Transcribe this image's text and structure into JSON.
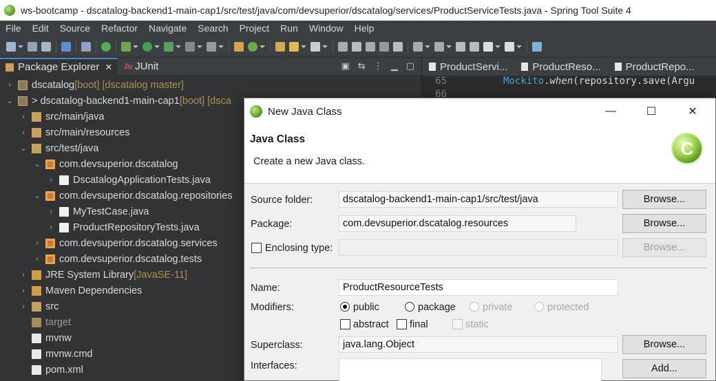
{
  "window": {
    "title": "ws-bootcamp - dscatalog-backend1-main-cap1/src/test/java/com/devsuperior/dscatalog/services/ProductServiceTests.java - Spring Tool Suite 4"
  },
  "menu": [
    "File",
    "Edit",
    "Source",
    "Refactor",
    "Navigate",
    "Search",
    "Project",
    "Run",
    "Window",
    "Help"
  ],
  "left_panel": {
    "tabs": [
      {
        "label": "Package Explorer",
        "close": "✕",
        "active": true
      },
      {
        "label": "JUnit",
        "prefix": "Ju"
      }
    ],
    "tree": [
      {
        "label": "dscatalog",
        "suffix": " [boot] [dscatalog master]",
        "level": 0,
        "chev": "›",
        "icon": "project"
      },
      {
        "label": "> dscatalog-backend1-main-cap1",
        "suffix": " [boot] [dsca",
        "level": 0,
        "chev": "⌄",
        "icon": "project"
      },
      {
        "label": "src/main/java",
        "level": 1,
        "chev": "›",
        "icon": "srcfolder"
      },
      {
        "label": "src/main/resources",
        "level": 1,
        "chev": "›",
        "icon": "srcfolder"
      },
      {
        "label": "src/test/java",
        "level": 1,
        "chev": "⌄",
        "icon": "srcfolder"
      },
      {
        "label": "com.devsuperior.dscatalog",
        "level": 2,
        "chev": "⌄",
        "icon": "pkg"
      },
      {
        "label": "DscatalogApplicationTests.java",
        "level": 3,
        "chev": "›",
        "icon": "java"
      },
      {
        "label": "com.devsuperior.dscatalog.repositories",
        "level": 2,
        "chev": "⌄",
        "icon": "pkg"
      },
      {
        "label": "MyTestCase.java",
        "level": 3,
        "chev": "›",
        "icon": "java"
      },
      {
        "label": "ProductRepositoryTests.java",
        "level": 3,
        "chev": "›",
        "icon": "java"
      },
      {
        "label": "com.devsuperior.dscatalog.services",
        "level": 2,
        "chev": "›",
        "icon": "pkg"
      },
      {
        "label": "com.devsuperior.dscatalog.tests",
        "level": 2,
        "chev": "›",
        "icon": "pkg"
      },
      {
        "label": "JRE System Library",
        "suffix": " [JavaSE-11]",
        "level": 1,
        "chev": "›",
        "icon": "lib"
      },
      {
        "label": "Maven Dependencies",
        "level": 1,
        "chev": "›",
        "icon": "lib"
      },
      {
        "label": "src",
        "level": 1,
        "chev": "›",
        "icon": "folder"
      },
      {
        "label": "target",
        "level": 1,
        "chev": "",
        "icon": "targetfolder",
        "muted": true
      },
      {
        "label": "mvnw",
        "level": 1,
        "chev": "",
        "icon": "file"
      },
      {
        "label": "mvnw.cmd",
        "level": 1,
        "chev": "",
        "icon": "file"
      },
      {
        "label": "pom.xml",
        "level": 1,
        "chev": "",
        "icon": "file"
      }
    ]
  },
  "editor": {
    "tabs": [
      "ProductServi...",
      "ProductReso...",
      "ProductRepo..."
    ],
    "lines": [
      {
        "num": "65",
        "code_a": "Mockito",
        "code_b": ".",
        "code_c": "when",
        "code_d": "(repository.save(Argu"
      },
      {
        "num": "66",
        "code_a": "",
        "code_b": "",
        "code_c": "",
        "code_d": ""
      }
    ]
  },
  "dialog": {
    "title": "New Java Class",
    "header_title": "Java Class",
    "header_desc": "Create a new Java class.",
    "source_folder_label": "Source folder:",
    "source_folder_value": "dscatalog-backend1-main-cap1/src/test/java",
    "package_label": "Package:",
    "package_value": "com.devsuperior.dscatalog.resources",
    "enclosing_label": "Enclosing type:",
    "name_label": "Name:",
    "name_value": "ProductResourceTests",
    "modifiers_label": "Modifiers:",
    "mod_public": "public",
    "mod_package": "package",
    "mod_private": "private",
    "mod_protected": "protected",
    "mod_abstract": "abstract",
    "mod_final": "final",
    "mod_static": "static",
    "superclass_label": "Superclass:",
    "superclass_value": "java.lang.Object",
    "interfaces_label": "Interfaces:",
    "browse": "Browse...",
    "add": "Add...",
    "win_min": "—",
    "win_max": "☐",
    "win_close": "✕",
    "logo_letter": "C"
  }
}
